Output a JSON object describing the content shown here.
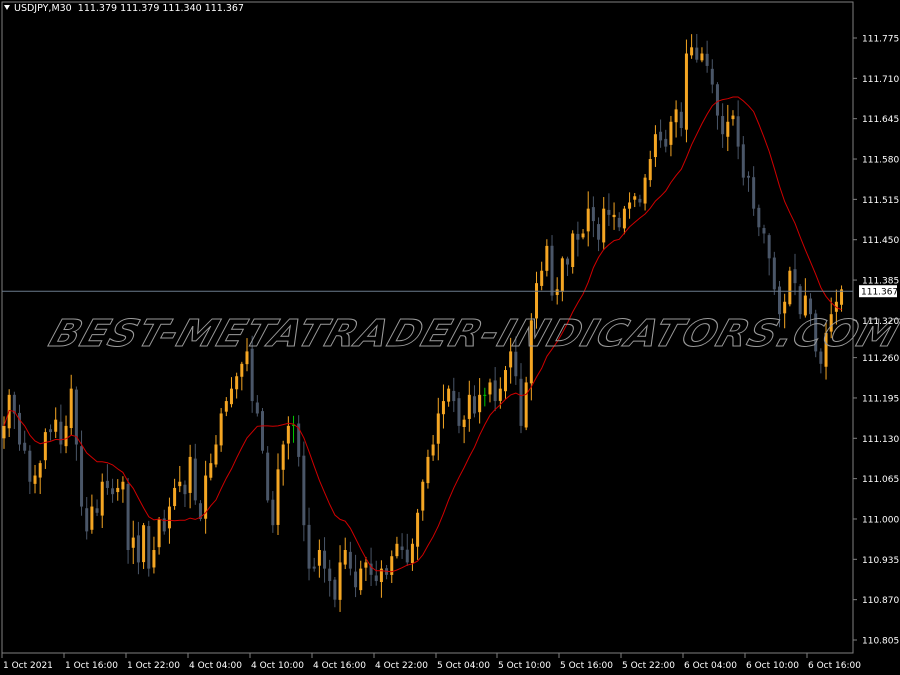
{
  "header": {
    "symbol": "USDJPY,M30",
    "ohlc_text": "111.379 111.379 111.340 111.367",
    "menu_icon": "triangle-down-icon"
  },
  "watermark": "BEST-METATRADER-INDICATORS.COM",
  "colors": {
    "background": "#000000",
    "bull": "#f5a623",
    "bear": "#4a5668",
    "doji": "#00c800",
    "ma_line": "#d00000",
    "axis": "#808080",
    "bid_line": "#6b7a8c",
    "text": "#ffffff"
  },
  "chart_data": {
    "type": "candlestick",
    "title": "USDJPY,M30",
    "symbol": "USDJPY",
    "timeframe": "M30",
    "last": {
      "open": 111.379,
      "high": 111.379,
      "low": 111.34,
      "close": 111.367
    },
    "current_price_label": "111.367",
    "current_price": 111.367,
    "ylim": [
      110.78,
      111.8
    ],
    "y_ticks": [
      "111.775",
      "111.710",
      "111.645",
      "111.580",
      "111.515",
      "111.450",
      "111.385",
      "111.320",
      "111.260",
      "111.195",
      "111.130",
      "111.065",
      "111.000",
      "110.935",
      "110.870",
      "110.805"
    ],
    "x_ticks": [
      {
        "label": "1 Oct 2021",
        "bar": 0
      },
      {
        "label": "1 Oct 16:00",
        "bar": 12
      },
      {
        "label": "1 Oct 22:00",
        "bar": 24
      },
      {
        "label": "4 Oct 04:00",
        "bar": 36
      },
      {
        "label": "4 Oct 10:00",
        "bar": 48
      },
      {
        "label": "4 Oct 16:00",
        "bar": 60
      },
      {
        "label": "4 Oct 22:00",
        "bar": 72
      },
      {
        "label": "5 Oct 04:00",
        "bar": 84
      },
      {
        "label": "5 Oct 10:00",
        "bar": 96
      },
      {
        "label": "5 Oct 16:00",
        "bar": 108
      },
      {
        "label": "5 Oct 22:00",
        "bar": 120
      },
      {
        "label": "6 Oct 04:00",
        "bar": 132
      },
      {
        "label": "6 Oct 10:00",
        "bar": 144
      },
      {
        "label": "6 Oct 16:00",
        "bar": 156
      }
    ],
    "grid": false,
    "indicator": {
      "name": "Moving Average",
      "color": "#d00000"
    },
    "closes": [
      111.15,
      111.2,
      111.17,
      111.12,
      111.11,
      111.06,
      111.07,
      111.09,
      111.14,
      111.14,
      111.16,
      111.12,
      111.15,
      111.21,
      111.12,
      111.02,
      110.98,
      111.02,
      111.01,
      111.06,
      111.05,
      111.04,
      111.05,
      111.06,
      110.95,
      110.97,
      110.93,
      110.99,
      110.92,
      110.95,
      111.0,
      110.98,
      111.02,
      111.05,
      111.06,
      111.04,
      111.1,
      111.03,
      111.0,
      111.07,
      111.09,
      111.12,
      111.17,
      111.19,
      111.21,
      111.23,
      111.25,
      111.27,
      111.19,
      111.17,
      111.11,
      111.03,
      110.99,
      111.08,
      111.12,
      111.15,
      111.15,
      111.1,
      110.99,
      110.92,
      110.92,
      110.95,
      110.92,
      110.9,
      110.87,
      110.93,
      110.95,
      110.92,
      110.89,
      110.92,
      110.93,
      110.91,
      110.9,
      110.92,
      110.91,
      110.94,
      110.96,
      110.95,
      110.93,
      110.96,
      111.01,
      111.06,
      111.1,
      111.12,
      111.17,
      111.19,
      111.21,
      111.19,
      111.15,
      111.16,
      111.2,
      111.17,
      111.2,
      111.2,
      111.22,
      111.19,
      111.21,
      111.24,
      111.27,
      111.23,
      111.15,
      111.22,
      111.32,
      111.38,
      111.4,
      111.44,
      111.36,
      111.37,
      111.42,
      111.41,
      111.46,
      111.45,
      111.46,
      111.5,
      111.48,
      111.45,
      111.5,
      111.49,
      111.49,
      111.47,
      111.5,
      111.51,
      111.52,
      111.51,
      111.55,
      111.58,
      111.62,
      111.61,
      111.6,
      111.64,
      111.66,
      111.63,
      111.75,
      111.76,
      111.74,
      111.75,
      111.73,
      111.7,
      111.65,
      111.62,
      111.64,
      111.65,
      111.6,
      111.55,
      111.55,
      111.5,
      111.47,
      111.46,
      111.42,
      111.37,
      111.33,
      111.35,
      111.4,
      111.38,
      111.33,
      111.36,
      111.33,
      111.27,
      111.25,
      111.3,
      111.33,
      111.35,
      111.37
    ]
  }
}
